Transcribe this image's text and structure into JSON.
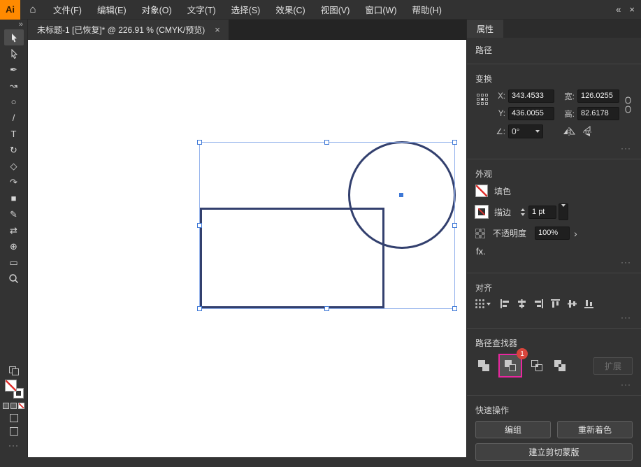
{
  "colors": {
    "highlight_magenta": "#e8279f",
    "badge_red": "#d8453c",
    "selection_blue": "#3e78d6",
    "shape_stroke_navy": "#33406e",
    "logo_orange": "#ff8a00"
  },
  "app": {
    "logo": "Ai",
    "home_icon": "⌂",
    "menus": [
      "文件(F)",
      "编辑(E)",
      "对象(O)",
      "文字(T)",
      "选择(S)",
      "效果(C)",
      "视图(V)",
      "窗口(W)",
      "帮助(H)"
    ],
    "collapse_icon": "«",
    "close_icon": "×"
  },
  "document_tab": {
    "title": "未标题-1 [已恢复]* @ 226.91 % (CMYK/预览)",
    "close": "×"
  },
  "toolbar": {
    "expand": "»",
    "more": "···",
    "tools": [
      {
        "name": "selection-tool"
      },
      {
        "name": "direct-selection-tool"
      },
      {
        "name": "pen-tool",
        "glyph": "✒"
      },
      {
        "name": "curvature-tool",
        "glyph": "↝"
      },
      {
        "name": "shaper-tool",
        "glyph": "○"
      },
      {
        "name": "line-tool",
        "glyph": "/"
      },
      {
        "name": "type-tool",
        "glyph": "T"
      },
      {
        "name": "rotate-tool",
        "glyph": "↻"
      },
      {
        "name": "eraser-tool",
        "glyph": "◇"
      },
      {
        "name": "rotate-view-tool",
        "glyph": "↷"
      },
      {
        "name": "rectangle-tool",
        "glyph": "■"
      },
      {
        "name": "pencil-tool",
        "glyph": "✎"
      },
      {
        "name": "transform-tool",
        "glyph": "⇄"
      },
      {
        "name": "width-tool",
        "glyph": "⊕"
      },
      {
        "name": "artboard-tool",
        "glyph": "▭"
      },
      {
        "name": "zoom-tool"
      }
    ]
  },
  "panel": {
    "tab": "属性",
    "object_type": "路径",
    "transform": {
      "title": "变换",
      "x_label": "X:",
      "x_value": "343.4533",
      "y_label": "Y:",
      "y_value": "436.0055",
      "w_label": "宽:",
      "w_value": "126.0255",
      "h_label": "高:",
      "h_value": "82.6178",
      "angle_label": "∠:",
      "angle_value": "0°",
      "more": "···"
    },
    "appearance": {
      "title": "外观",
      "fill_label": "填色",
      "stroke_label": "描边",
      "stroke_weight": "1 pt",
      "opacity_label": "不透明度",
      "opacity_value": "100%",
      "opacity_chevron": "›",
      "fx_label": "fx.",
      "more": "···"
    },
    "align": {
      "title": "对齐",
      "more": "···"
    },
    "pathfinder": {
      "title": "路径查找器",
      "badge": "1",
      "expand_label": "扩展",
      "more": "···"
    },
    "quick_actions": {
      "title": "快速操作",
      "group": "编组",
      "recolor": "重新着色",
      "clipping_mask": "建立剪切蒙版"
    }
  }
}
